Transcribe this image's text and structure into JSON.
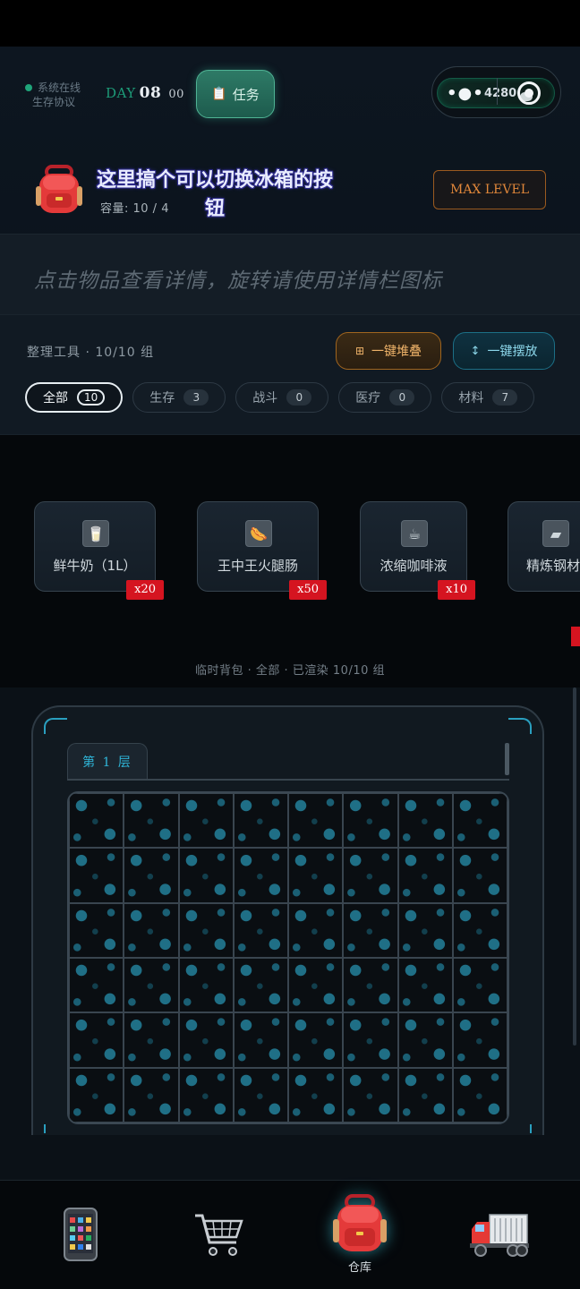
{
  "header": {
    "status_text": "系统在线",
    "status_sub": "生存协议",
    "day_label": "DAY",
    "day_number": "08",
    "day_suffix": "00",
    "task_button": "任务",
    "coins": "4280",
    "accent_color": "#1fa57a"
  },
  "storage": {
    "overlay_note": "这里搞个可以切换冰箱的按钮",
    "capacity": "容量: 10 / 4",
    "max_level_button": "MAX LEVEL"
  },
  "hint": {
    "text": "点击物品查看详情，旋转请使用详情栏图标"
  },
  "tools": {
    "title": "整理工具 · 10/10 组",
    "stack_button": "一键堆叠",
    "arrange_button": "一键摆放",
    "filters": [
      {
        "label": "全部",
        "count": "10",
        "active": true
      },
      {
        "label": "生存",
        "count": "3",
        "active": false
      },
      {
        "label": "战斗",
        "count": "0",
        "active": false
      },
      {
        "label": "医疗",
        "count": "0",
        "active": false
      },
      {
        "label": "材料",
        "count": "7",
        "active": false
      }
    ]
  },
  "temp_bag": {
    "items": [
      {
        "name": "鲜牛奶（1L）",
        "qty": "x20",
        "icon": "milk-icon"
      },
      {
        "name": "王中王火腿肠",
        "qty": "x50",
        "icon": "sausage-icon"
      },
      {
        "name": "浓缩咖啡液",
        "qty": "x10",
        "icon": "coffee-icon"
      },
      {
        "name": "精炼钢材",
        "qty": "",
        "icon": "steel-icon"
      }
    ],
    "caption": "临时背包 · 全部 · 已渲染 10/10 组"
  },
  "grid": {
    "layer_tab": "第 1 层",
    "columns": 8,
    "rows": 6
  },
  "nav": {
    "items": [
      {
        "icon": "phone-icon"
      },
      {
        "icon": "cart-icon"
      },
      {
        "icon": "backpack-icon",
        "label": "仓库"
      },
      {
        "icon": "truck-icon"
      }
    ]
  }
}
